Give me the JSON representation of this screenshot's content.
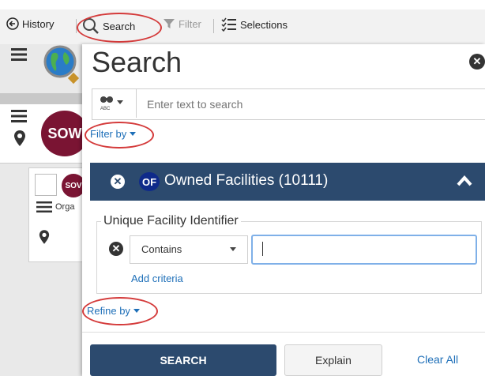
{
  "toolbar": {
    "history_label": "History",
    "search_label": "Search",
    "filter_label": "Filter",
    "selections_label": "Selections"
  },
  "background_app": {
    "badge_text": "SOW",
    "small_badge_text": "SOV",
    "row_label": "Orga"
  },
  "panel": {
    "title": "Search",
    "search_placeholder": "Enter text to search",
    "filter_by_label": "Filter by",
    "refine_by_label": "Refine by"
  },
  "facility_section": {
    "badge": "OF",
    "title": "Owned Facilities (10111)",
    "criteria_legend": "Unique Facility Identifier",
    "operator_value": "Contains",
    "value": "",
    "add_criteria_label": "Add criteria"
  },
  "actions": {
    "search_label": "SEARCH",
    "explain_label": "Explain",
    "clear_all_label": "Clear All"
  },
  "colors": {
    "accent": "#2c4a6e",
    "brand_badge": "#7a1433",
    "highlight": "#d43a3a",
    "link": "#1e6fb8"
  }
}
